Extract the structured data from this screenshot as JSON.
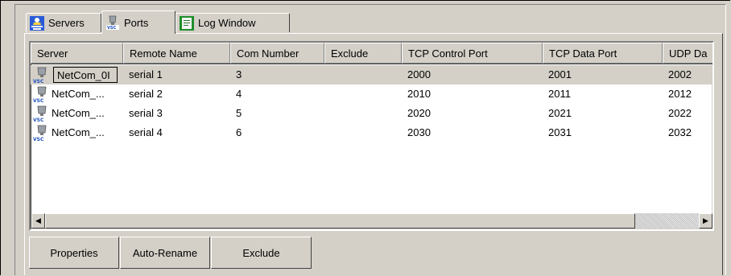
{
  "tabs": [
    {
      "label": "Servers",
      "icon": "servers-icon"
    },
    {
      "label": "Ports",
      "icon": "port-device-icon",
      "active": true
    },
    {
      "label": "Log Window",
      "icon": "log-window-icon"
    }
  ],
  "columns": [
    "Server",
    "Remote Name",
    "Com Number",
    "Exclude",
    "TCP Control Port",
    "TCP Data Port",
    "UDP Da"
  ],
  "rows": [
    {
      "server": "NetCom_0I",
      "remote_name": "serial 1",
      "com_number": "3",
      "exclude": "",
      "tcp_control_port": "2000",
      "tcp_data_port": "2001",
      "udp_data": "2002",
      "selected": true,
      "editing": true
    },
    {
      "server": "NetCom_...",
      "remote_name": "serial 2",
      "com_number": "4",
      "exclude": "",
      "tcp_control_port": "2010",
      "tcp_data_port": "2011",
      "udp_data": "2012"
    },
    {
      "server": "NetCom_...",
      "remote_name": "serial 3",
      "com_number": "5",
      "exclude": "",
      "tcp_control_port": "2020",
      "tcp_data_port": "2021",
      "udp_data": "2022"
    },
    {
      "server": "NetCom_...",
      "remote_name": "serial 4",
      "com_number": "6",
      "exclude": "",
      "tcp_control_port": "2030",
      "tcp_data_port": "2031",
      "udp_data": "2032"
    }
  ],
  "buttons": {
    "properties": "Properties",
    "auto_rename": "Auto-Rename",
    "exclude": "Exclude"
  },
  "scrollbar": {
    "left_arrow": "◀",
    "right_arrow": "▶"
  },
  "colors": {
    "face": "#d4d0c8",
    "selected_row": "#d4d0c8"
  }
}
